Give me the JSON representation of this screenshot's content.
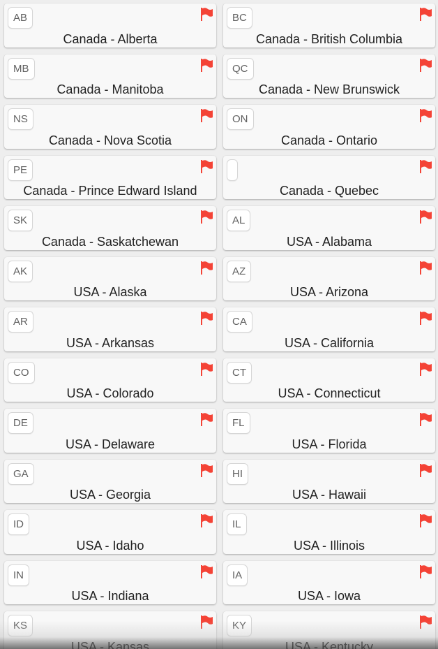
{
  "accent_flag_color": "#f44336",
  "flag_icon": "flag-icon",
  "regions": [
    {
      "code": "AB",
      "name": "Canada - Alberta"
    },
    {
      "code": "BC",
      "name": "Canada - British Columbia"
    },
    {
      "code": "MB",
      "name": "Canada - Manitoba"
    },
    {
      "code": "QC",
      "name": "Canada - New Brunswick"
    },
    {
      "code": "NS",
      "name": "Canada - Nova Scotia"
    },
    {
      "code": "ON",
      "name": "Canada - Ontario"
    },
    {
      "code": "PE",
      "name": "Canada - Prince Edward Island"
    },
    {
      "code": "",
      "name": "Canada - Quebec"
    },
    {
      "code": "SK",
      "name": "Canada - Saskatchewan"
    },
    {
      "code": "AL",
      "name": "USA - Alabama"
    },
    {
      "code": "AK",
      "name": "USA - Alaska"
    },
    {
      "code": "AZ",
      "name": "USA - Arizona"
    },
    {
      "code": "AR",
      "name": "USA - Arkansas"
    },
    {
      "code": "CA",
      "name": "USA - California"
    },
    {
      "code": "CO",
      "name": "USA - Colorado"
    },
    {
      "code": "CT",
      "name": "USA - Connecticut"
    },
    {
      "code": "DE",
      "name": "USA - Delaware"
    },
    {
      "code": "FL",
      "name": "USA - Florida"
    },
    {
      "code": "GA",
      "name": "USA - Georgia"
    },
    {
      "code": "HI",
      "name": "USA - Hawaii"
    },
    {
      "code": "ID",
      "name": "USA - Idaho"
    },
    {
      "code": "IL",
      "name": "USA - Illinois"
    },
    {
      "code": "IN",
      "name": "USA - Indiana"
    },
    {
      "code": "IA",
      "name": "USA - Iowa"
    },
    {
      "code": "KS",
      "name": "USA - Kansas"
    },
    {
      "code": "KY",
      "name": "USA - Kentucky"
    }
  ]
}
